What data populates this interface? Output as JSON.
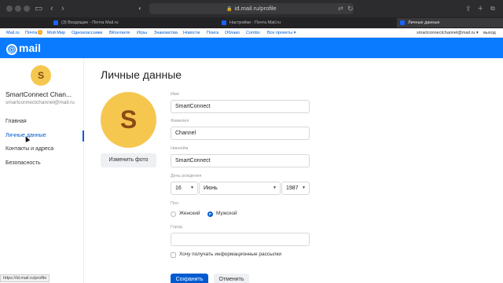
{
  "browser": {
    "url": "id.mail.ru/profile",
    "tabs": [
      {
        "label": "(3) Входящие - Почта Mail.ru"
      },
      {
        "label": "Настройки - Почта Mail.ru"
      },
      {
        "label": "Личные данные"
      }
    ],
    "status_url": "https://id.mail.ru/profile"
  },
  "portal_nav": {
    "items": [
      "Mail.ru",
      "Почта",
      "Мой Мир",
      "Одноклассники",
      "ВКонтакте",
      "Игры",
      "Знакомства",
      "Новости",
      "Поиск",
      "Облако",
      "Combo",
      "Все проекты ▾"
    ],
    "mail_badge": "1",
    "user_email": "smartconnectchannel@mail.ru ▾",
    "logout": "выход"
  },
  "header": {
    "logo": "mail",
    "logo_at": "@"
  },
  "sidebar": {
    "avatar_letter": "S",
    "name": "SmartConnect Chan...",
    "email": "smartconnectchannel@mail.ru",
    "items": [
      {
        "label": "Главная"
      },
      {
        "label": "Личные данные"
      },
      {
        "label": "Контакты и адреса"
      },
      {
        "label": "Безопасность"
      }
    ]
  },
  "main": {
    "title": "Личные данные",
    "avatar_letter": "S",
    "change_photo_label": "Изменить фото",
    "first_name_label": "Имя",
    "first_name_value": "SmartConnect",
    "last_name_label": "Фамилия",
    "last_name_value": "Channel",
    "nickname_label": "Никнейм",
    "nickname_value": "SmartConnect",
    "birthday_label": "День рождения",
    "birth_day": "16",
    "birth_month": "Июнь",
    "birth_year": "1987",
    "gender_label": "Пол",
    "gender_female": "Женский",
    "gender_male": "Мужской",
    "city_label": "Город",
    "city_value": "",
    "newsletter_label": "Хочу получать информационные рассылки",
    "save_label": "Сохранить",
    "cancel_label": "Отменить"
  },
  "colors": {
    "accent": "#005bd1",
    "header": "#0a7bff",
    "avatar": "#f6c74f"
  }
}
